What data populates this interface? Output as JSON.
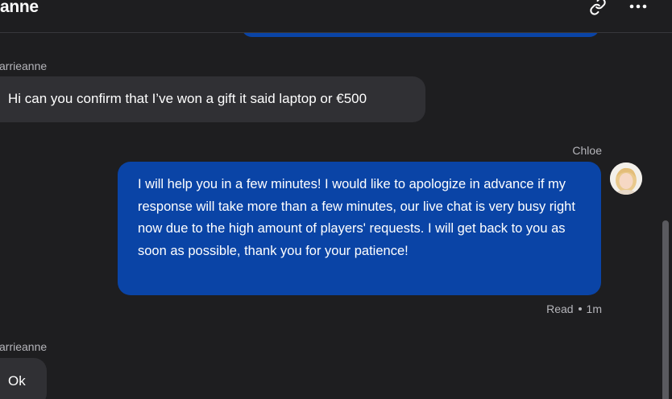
{
  "header": {
    "title": "anne",
    "link_icon": "link-icon",
    "more_icon": "more-horizontal-icon"
  },
  "messages": [
    {
      "sender": "arrieanne",
      "text": "Hi can you confirm that I’ve won a gift it said laptop or €500",
      "side": "left"
    },
    {
      "sender": "Chloe",
      "text": "I will help you in a few minutes! I would like to apologize in advance if my response will take more than a few minutes, our live chat is very busy right now due to the high amount of players' requests. I will get back to you as soon as possible, thank you for your patience!",
      "side": "right",
      "status": "Read",
      "time": "1m"
    },
    {
      "sender": "arrieanne",
      "text": "Ok",
      "side": "left"
    }
  ],
  "colors": {
    "background": "#1e1e20",
    "agent_bubble": "#0a44a6",
    "user_bubble": "#303034",
    "muted_text": "#b5b5ba"
  }
}
